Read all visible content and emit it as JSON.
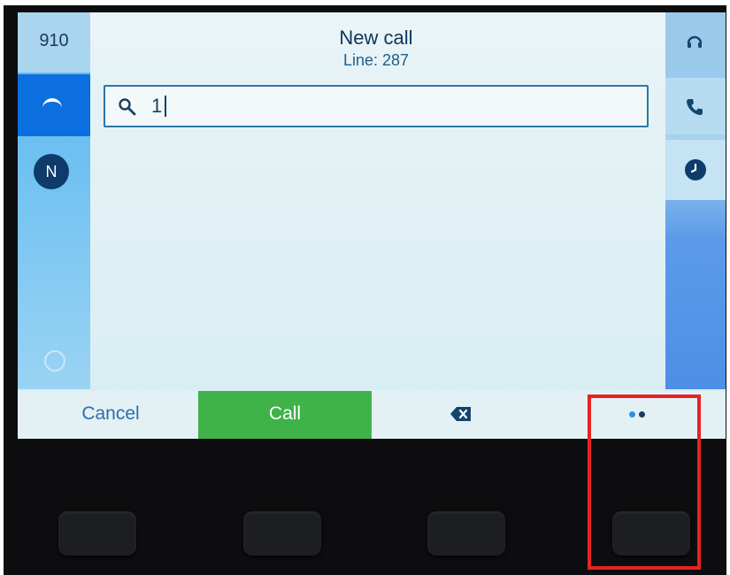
{
  "header": {
    "title": "New call",
    "line_label": "Line: 287"
  },
  "left_sidebar": {
    "line_number": "910",
    "active_line_icon": "handset-icon",
    "contact_avatar_letter": "N"
  },
  "right_sidebar": {
    "icons": [
      "headset-icon",
      "phone-icon",
      "clock-icon"
    ]
  },
  "search": {
    "icon": "search-icon",
    "value": "1"
  },
  "softkeys": {
    "cancel_label": "Cancel",
    "call_label": "Call",
    "backspace_icon": "backspace-icon",
    "more_icon": "more-dots-icon"
  },
  "colors": {
    "call_button": "#3fb24a",
    "active_line": "#0b6fe0",
    "highlight": "#e82221",
    "avatar": "#0e3b69"
  },
  "annotation": {
    "highlight_target": "more-softkey-physical-button"
  }
}
